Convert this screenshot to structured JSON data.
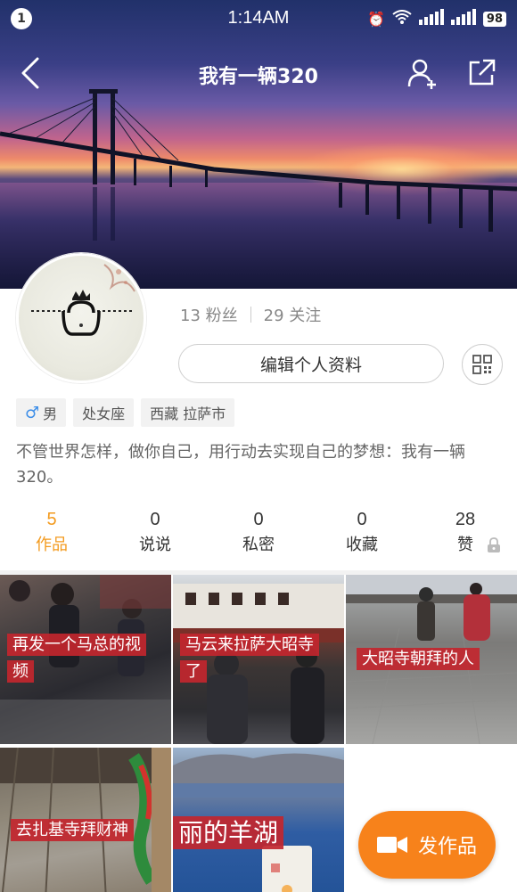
{
  "status_bar": {
    "notification_count": "1",
    "time": "1:14AM",
    "battery": "98"
  },
  "nav": {
    "title": "我有一辆320"
  },
  "profile": {
    "followers_text": "13 粉丝",
    "following_text": "29 关注",
    "edit_button": "编辑个人资料",
    "tags": [
      {
        "label": "男",
        "icon": "male-icon"
      },
      {
        "label": "处女座"
      },
      {
        "label": "西藏 拉萨市"
      }
    ],
    "bio": "不管世界怎样，做你自己，用行动去实现自己的梦想：我有一辆320。"
  },
  "counters": [
    {
      "num": "5",
      "label": "作品",
      "active": true
    },
    {
      "num": "0",
      "label": "说说"
    },
    {
      "num": "0",
      "label": "私密"
    },
    {
      "num": "0",
      "label": "收藏"
    },
    {
      "num": "28",
      "label": "赞",
      "locked": true
    }
  ],
  "works": [
    {
      "caption": "再发一个马总的视频"
    },
    {
      "caption": "马云来拉萨大昭寺了"
    },
    {
      "caption": "大昭寺朝拜的人"
    },
    {
      "caption": "去扎基寺拜财神"
    },
    {
      "caption": "丽的羊湖"
    }
  ],
  "fab": {
    "label": "发作品"
  },
  "colors": {
    "accent": "#f39a1e",
    "fab": "#f7821b",
    "caption_bg": "#c2262e"
  }
}
